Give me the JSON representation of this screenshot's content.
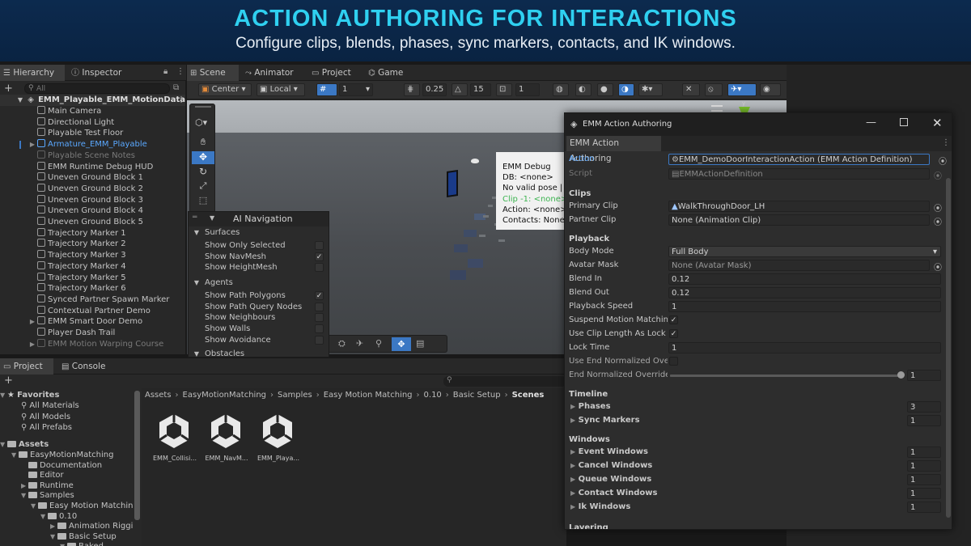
{
  "banner": {
    "title": "ACTION AUTHORING FOR INTERACTIONS",
    "subtitle": "Configure clips, blends, phases, sync markers, contacts, and IK windows."
  },
  "hierarchy": {
    "tab_hierarchy": "Hierarchy",
    "tab_inspector": "Inspector",
    "search_placeholder": "All",
    "root": "EMM_Playable_EMM_MotionData",
    "items": [
      {
        "label": "Main Camera"
      },
      {
        "label": "Directional Light"
      },
      {
        "label": "Playable Test Floor"
      },
      {
        "label": "Armature_EMM_Playable",
        "highlight": "blue"
      },
      {
        "label": "Playable Scene Notes",
        "dim": true
      },
      {
        "label": "EMM Runtime Debug HUD"
      },
      {
        "label": "Uneven Ground Block 1"
      },
      {
        "label": "Uneven Ground Block 2"
      },
      {
        "label": "Uneven Ground Block 3"
      },
      {
        "label": "Uneven Ground Block 4"
      },
      {
        "label": "Uneven Ground Block 5"
      },
      {
        "label": "Trajectory Marker 1"
      },
      {
        "label": "Trajectory Marker 2"
      },
      {
        "label": "Trajectory Marker 3"
      },
      {
        "label": "Trajectory Marker 4"
      },
      {
        "label": "Trajectory Marker 5"
      },
      {
        "label": "Trajectory Marker 6"
      },
      {
        "label": "Synced Partner Spawn Marker"
      },
      {
        "label": "Contextual Partner Demo"
      },
      {
        "label": "EMM Smart Door Demo"
      },
      {
        "label": "Player Dash Trail"
      },
      {
        "label": "EMM Motion Warping Course",
        "dim": true
      }
    ]
  },
  "scene": {
    "tabs": [
      "Scene",
      "Animator",
      "Project",
      "Game"
    ],
    "toolbar": {
      "pivot": "Center",
      "space": "Local",
      "grid_value": "1",
      "snap_value": "0.25",
      "angle_value": "15",
      "scale_value": "1"
    },
    "debug_overlay": {
      "lines": [
        "EMM Debug",
        "DB: <none>",
        "No valid pose | Sp",
        "Clip -1: <none>",
        "Action: <none>",
        "Contacts: None"
      ]
    },
    "ai_navigation": {
      "title": "AI Navigation",
      "surfaces_header": "Surfaces",
      "surfaces": [
        {
          "label": "Show Only Selected",
          "checked": false
        },
        {
          "label": "Show NavMesh",
          "checked": true
        },
        {
          "label": "Show HeightMesh",
          "checked": false
        }
      ],
      "agents_header": "Agents",
      "agents": [
        {
          "label": "Show Path Polygons",
          "checked": true
        },
        {
          "label": "Show Path Query Nodes",
          "checked": false
        },
        {
          "label": "Show Neighbours",
          "checked": false
        },
        {
          "label": "Show Walls",
          "checked": false
        },
        {
          "label": "Show Avoidance",
          "checked": false
        }
      ],
      "obstacles_header": "Obstacles"
    }
  },
  "project": {
    "tab_project": "Project",
    "tab_console": "Console",
    "favorites_header": "Favorites",
    "favorites": [
      "All Materials",
      "All Models",
      "All Prefabs"
    ],
    "assets_header": "Assets",
    "tree": [
      {
        "label": "EasyMotionMatching",
        "indent": 1
      },
      {
        "label": "Documentation",
        "indent": 2
      },
      {
        "label": "Editor",
        "indent": 2
      },
      {
        "label": "Runtime",
        "indent": 2
      },
      {
        "label": "Samples",
        "indent": 2
      },
      {
        "label": "Easy Motion Matchin",
        "indent": 3
      },
      {
        "label": "0.10",
        "indent": 4
      },
      {
        "label": "Animation Riggir",
        "indent": 5
      },
      {
        "label": "Basic Setup",
        "indent": 5
      },
      {
        "label": "Baked",
        "indent": 6
      }
    ],
    "breadcrumb": [
      "Assets",
      "EasyMotionMatching",
      "Samples",
      "Easy Motion Matching",
      "0.10",
      "Basic Setup",
      "Scenes"
    ],
    "assets": [
      "EMM_Collisi...",
      "EMM_NavM...",
      "EMM_Playa..."
    ]
  },
  "authoring": {
    "window_title": "EMM Action Authoring",
    "tab": "EMM Action Authoring",
    "action_label": "Action",
    "action_value": "EMM_DemoDoorInteractionAction (EMM Action Definition)",
    "script_label": "Script",
    "script_value": "EMMActionDefinition",
    "clips_header": "Clips",
    "primary_clip_label": "Primary Clip",
    "primary_clip_value": "WalkThroughDoor_LH",
    "partner_clip_label": "Partner Clip",
    "partner_clip_value": "None (Animation Clip)",
    "playback_header": "Playback",
    "body_mode_label": "Body Mode",
    "body_mode_value": "Full Body",
    "avatar_mask_label": "Avatar Mask",
    "avatar_mask_value": "None (Avatar Mask)",
    "blend_in_label": "Blend In",
    "blend_in_value": "0.12",
    "blend_out_label": "Blend Out",
    "blend_out_value": "0.12",
    "playback_speed_label": "Playback Speed",
    "playback_speed_value": "1",
    "suspend_label": "Suspend Motion Matching",
    "suspend_checked": true,
    "clip_lock_label": "Use Clip Length As Lock T",
    "clip_lock_checked": true,
    "lock_time_label": "Lock Time",
    "lock_time_value": "1",
    "use_end_label": "Use End Normalized Overr",
    "use_end_checked": false,
    "end_override_label": "End Normalized Override",
    "end_override_value": "1",
    "end_override_fraction": 1.0,
    "timeline_header": "Timeline",
    "phases_label": "Phases",
    "phases_value": "3",
    "sync_label": "Sync Markers",
    "sync_value": "1",
    "windows_header": "Windows",
    "event_label": "Event Windows",
    "event_value": "1",
    "cancel_label": "Cancel Windows",
    "cancel_value": "1",
    "queue_label": "Queue Windows",
    "queue_value": "1",
    "contact_label": "Contact Windows",
    "contact_value": "1",
    "ik_label": "Ik Windows",
    "ik_value": "1",
    "layering_header": "Layering"
  },
  "colors": {
    "banner_title": "#2fd0f0",
    "accent_blue": "#3b78c4",
    "link_blue": "#5aa8ff",
    "debug_green": "#3cb450"
  }
}
